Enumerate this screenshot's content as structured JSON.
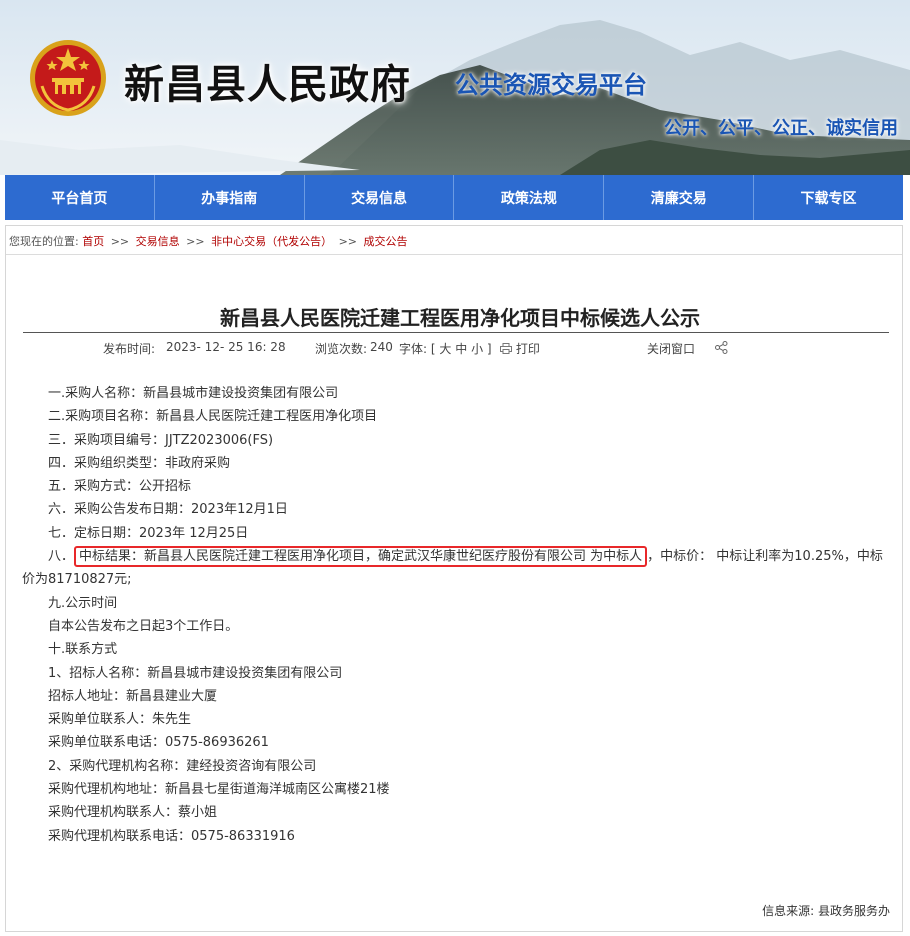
{
  "header": {
    "site_title": "新昌县人民政府",
    "platform_name": "公共资源交易平台",
    "motto": "公开、公平、公正、诚实信用"
  },
  "nav": {
    "items": [
      "平台首页",
      "办事指南",
      "交易信息",
      "政策法规",
      "清廉交易",
      "下载专区"
    ]
  },
  "breadcrumb": {
    "prefix": "您现在的位置:",
    "items": [
      "首页",
      "交易信息",
      "非中心交易（代发公告）",
      "成交公告"
    ],
    "separator": ">>"
  },
  "article": {
    "title": "新昌县人民医院迁建工程医用净化项目中标候选人公示",
    "meta": {
      "publish_label": "发布时间:",
      "publish_time": "2023- 12- 25   16: 28",
      "views_label": "浏览次数:",
      "views": "240",
      "font_label": "字体: [",
      "font_large": "大",
      "font_medium": "中",
      "font_small": "小",
      "font_end": "]",
      "print": "打印",
      "close": "关闭窗口"
    },
    "lines": {
      "l1": "一.采购人名称：新昌县城市建设投资集团有限公司",
      "l2": "二.采购项目名称：新昌县人民医院迁建工程医用净化项目",
      "l3": "三．采购项目编号：JJTZ2023006(FS)",
      "l4": "四．采购组织类型：非政府采购",
      "l5": "五．采购方式：公开招标",
      "l6": "六．采购公告发布日期：2023年12月1日",
      "l7": "七．定标日期：2023年 12月25日",
      "l8_prefix": "八．",
      "l8_highlight": "中标结果：新昌县人民医院迁建工程医用净化项目，确定武汉华康世纪医疗股份有限公司 为中标人",
      "l8_rest": "，中标价： 中标让利率为10.25%，中标价为81710827元;",
      "l9": "九.公示时间",
      "l10": "自本公告发布之日起3个工作日。",
      "l11": "十.联系方式",
      "l12": "1、招标人名称：新昌县城市建设投资集团有限公司",
      "l13": "招标人地址：新昌县建业大厦",
      "l14": "采购单位联系人：朱先生",
      "l15": "采购单位联系电话：0575-86936261",
      "l16": "2、采购代理机构名称：建经投资咨询有限公司",
      "l17": "采购代理机构地址：新昌县七星街道海洋城南区公寓楼21楼",
      "l18": "采购代理机构联系人：蔡小姐",
      "l19": "采购代理机构联系电话：0575-86331916"
    },
    "source_label": "信息来源:",
    "source": "县政务服务办"
  },
  "colors": {
    "nav_bg": "#2d6bd0",
    "platform_text": "#1a55b4",
    "breadcrumb_link": "#b00000",
    "highlight_border": "#e8282a"
  },
  "icons": [
    "national-emblem-icon",
    "print-icon",
    "share-icon"
  ]
}
